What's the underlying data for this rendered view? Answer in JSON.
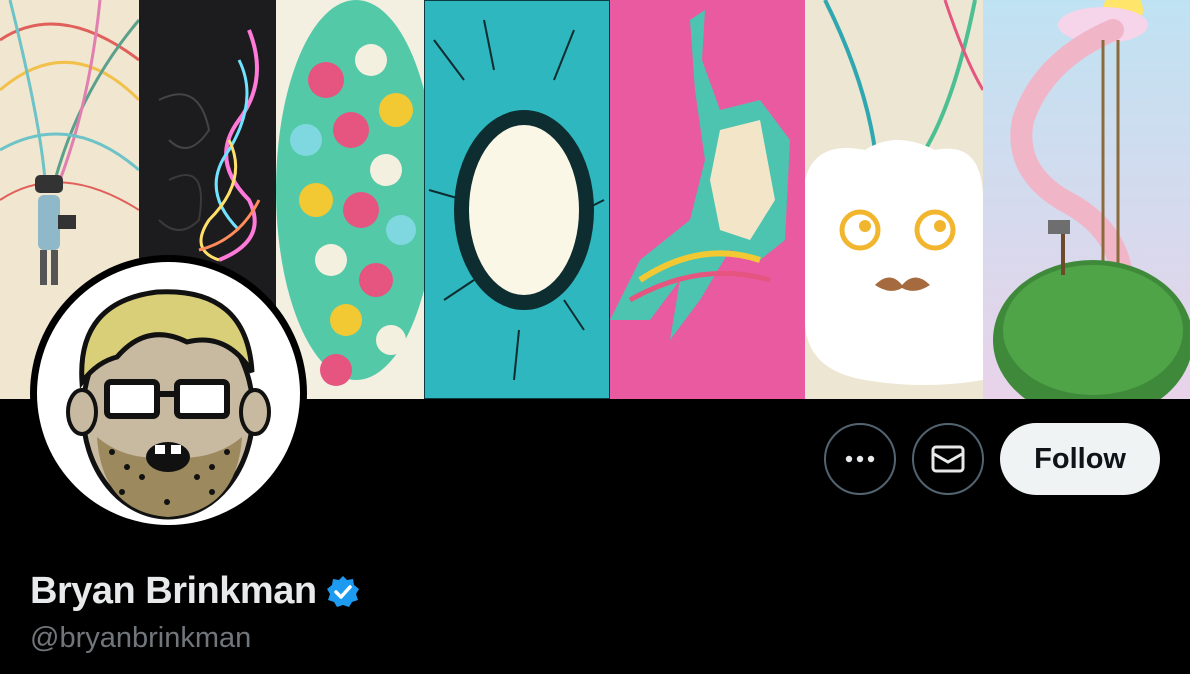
{
  "profile": {
    "display_name": "Bryan Brinkman",
    "handle": "@bryanbrinkman",
    "verified": true
  },
  "actions": {
    "more_icon": "more-horizontal-icon",
    "message_icon": "envelope-icon",
    "follow_label": "Follow"
  },
  "colors": {
    "background": "#000000",
    "verified_badge": "#1d9bf0",
    "follow_button_bg": "#eff3f4",
    "handle_text": "#71767b"
  },
  "banner": {
    "panels": [
      "vr-figure-with-wires",
      "neon-scribbles",
      "rose-bouquet",
      "cyan-spiky-ring",
      "pink-jumping-figure",
      "cloud-with-mustache",
      "pink-slide-on-grass-hill"
    ]
  }
}
